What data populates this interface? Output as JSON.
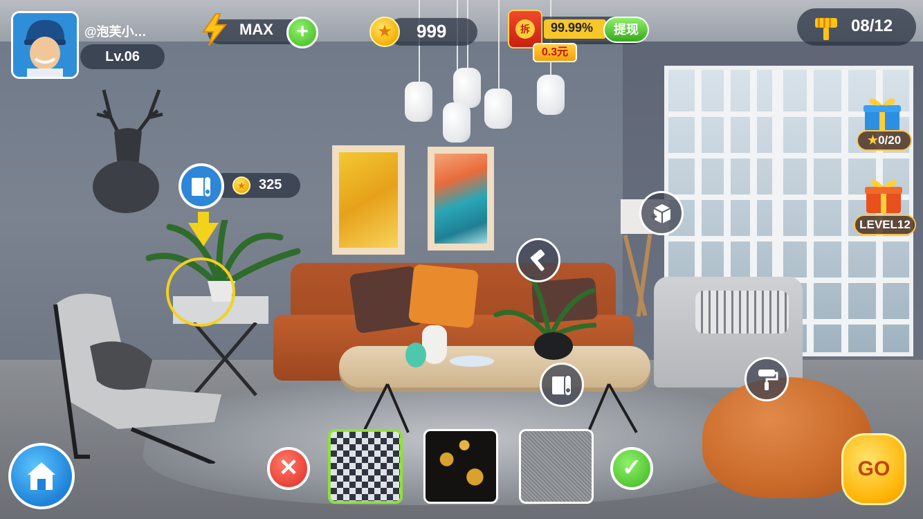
{
  "player": {
    "name": "@泡芙小…",
    "level": "Lv.06",
    "avatar_icon": "worker-avatar-icon"
  },
  "energy": {
    "value": "MAX",
    "icon": "lightning-icon",
    "add_icon": "plus-icon"
  },
  "coins": {
    "value": "999",
    "icon": "star-coin-icon"
  },
  "cash": {
    "packet_label": "拆",
    "progress_text": "99.99%",
    "progress_fraction": 0.9999,
    "withdraw_label": "提现",
    "amount": "0.3元"
  },
  "tasks": {
    "value": "08/12",
    "icon": "paint-brush-icon"
  },
  "rewards": [
    {
      "label": "0/20",
      "icon": "star-gift-icon"
    },
    {
      "label": "LEVEL12",
      "icon": "level-gift-icon"
    }
  ],
  "upgrade_hint": {
    "cost": "325",
    "item_icon": "wallpaper-roll-icon"
  },
  "actions": {
    "furniture_icon": "add-furniture-icon",
    "build_icon": "hammer-icon",
    "wallpaper_icon": "wallpaper-roll-icon",
    "paint_icon": "paint-roller-icon"
  },
  "bottom": {
    "home_icon": "home-icon",
    "cancel_icon": "close-icon",
    "confirm_icon": "check-icon",
    "go_label": "GO",
    "swatches": [
      {
        "name": "houndstooth",
        "selected": true
      },
      {
        "name": "black-gold-floral",
        "selected": false
      },
      {
        "name": "gray-linen",
        "selected": false
      }
    ]
  },
  "colors": {
    "accent_green": "#3eb51f",
    "selected_swatch_border": "#8fe03a",
    "hint_yellow": "#f3d21b",
    "hud_pill": "#283040"
  }
}
